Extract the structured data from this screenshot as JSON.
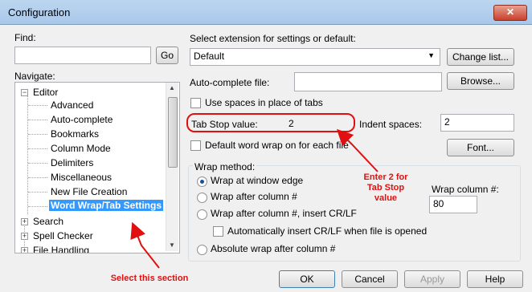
{
  "window": {
    "title": "Configuration",
    "close_glyph": "✕"
  },
  "find": {
    "label": "Find:",
    "value": "",
    "go_label": "Go"
  },
  "navigate": {
    "label": "Navigate:",
    "items": [
      {
        "label": "Editor",
        "toggle": "−"
      },
      {
        "label": "Advanced"
      },
      {
        "label": "Auto-complete"
      },
      {
        "label": "Bookmarks"
      },
      {
        "label": "Column Mode"
      },
      {
        "label": "Delimiters"
      },
      {
        "label": "Miscellaneous"
      },
      {
        "label": "New File Creation"
      },
      {
        "label": "Word Wrap/Tab Settings",
        "selected": true
      },
      {
        "label": "Search",
        "toggle": "+"
      },
      {
        "label": "Spell Checker",
        "toggle": "+"
      },
      {
        "label": "File Handling",
        "toggle": "+"
      }
    ]
  },
  "extension": {
    "label": "Select extension for settings or default:",
    "selected": "Default",
    "change_list_label": "Change list..."
  },
  "autocomplete": {
    "label": "Auto-complete file:",
    "value": "",
    "browse_label": "Browse..."
  },
  "use_spaces": {
    "label": "Use spaces in place of tabs",
    "checked": false
  },
  "tab_stop": {
    "label": "Tab Stop value:",
    "value": "2"
  },
  "indent": {
    "label": "Indent spaces:",
    "value": "2"
  },
  "default_wrap": {
    "label": "Default word wrap on for each file",
    "checked": false
  },
  "font_label": "Font...",
  "wrap_method": {
    "legend": "Wrap method:",
    "options": [
      {
        "label": "Wrap at window edge",
        "selected": true
      },
      {
        "label": "Wrap after column #",
        "selected": false
      },
      {
        "label": "Wrap after column #, insert CR/LF",
        "selected": false
      },
      {
        "label": "Absolute wrap after column #",
        "selected": false
      }
    ],
    "auto_insert": {
      "label": "Automatically insert CR/LF when file is opened",
      "checked": false
    },
    "wrap_column": {
      "label": "Wrap column #:",
      "value": "80"
    }
  },
  "buttons": {
    "ok": "OK",
    "cancel": "Cancel",
    "apply": "Apply",
    "help": "Help"
  },
  "annotations": {
    "enter_tab_stop": [
      "Enter 2 for",
      "Tab Stop",
      "value"
    ],
    "select_section": "Select this section",
    "color": "#e01010"
  },
  "colors": {
    "selection": "#3399ff",
    "accent_red": "#e01010"
  }
}
